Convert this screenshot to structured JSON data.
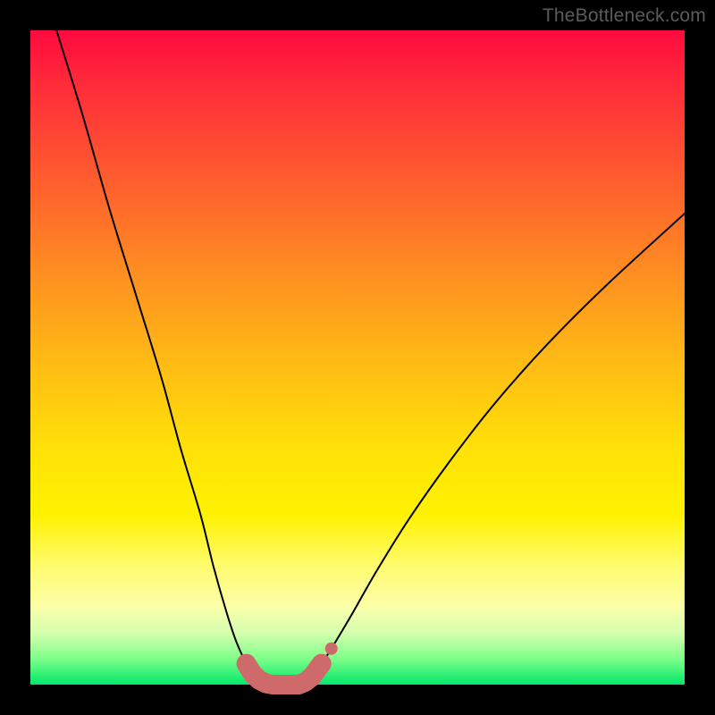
{
  "watermark": "TheBottleneck.com",
  "colors": {
    "frame": "#000000",
    "curve": "#000000",
    "marker": "#cf6a6a"
  },
  "chart_data": {
    "type": "line",
    "title": "",
    "xlabel": "",
    "ylabel": "",
    "xlim": [
      0,
      100
    ],
    "ylim": [
      0,
      100
    ],
    "grid": false,
    "series": [
      {
        "name": "left-branch",
        "x": [
          4,
          8,
          12,
          16,
          20,
          23,
          26,
          28,
          30,
          31.5,
          33,
          34,
          35,
          36,
          37
        ],
        "y": [
          100,
          87,
          73,
          60,
          47,
          36,
          26,
          18,
          11,
          6.5,
          3.2,
          1.6,
          0.7,
          0.2,
          0
        ]
      },
      {
        "name": "right-branch",
        "x": [
          41,
          42,
          43,
          44,
          46,
          49,
          53,
          58,
          64,
          71,
          79,
          88,
          100
        ],
        "y": [
          0,
          0.4,
          1.2,
          2.4,
          5.5,
          10.5,
          17.5,
          25.5,
          34,
          43,
          52,
          61,
          72
        ]
      },
      {
        "name": "floor",
        "x": [
          37,
          38,
          39,
          40,
          41
        ],
        "y": [
          0,
          0,
          0,
          0,
          0
        ]
      }
    ],
    "markers": {
      "name": "highlight-cluster",
      "points": [
        {
          "x": 33.0,
          "y": 3.2
        },
        {
          "x": 34.0,
          "y": 1.6
        },
        {
          "x": 35.0,
          "y": 0.7
        },
        {
          "x": 36.0,
          "y": 0.2
        },
        {
          "x": 37.0,
          "y": 0.0
        },
        {
          "x": 38.0,
          "y": 0.0
        },
        {
          "x": 39.0,
          "y": 0.0
        },
        {
          "x": 40.0,
          "y": 0.0
        },
        {
          "x": 41.0,
          "y": 0.0
        },
        {
          "x": 42.0,
          "y": 0.4
        },
        {
          "x": 43.0,
          "y": 1.2
        },
        {
          "x": 44.5,
          "y": 3.2
        }
      ],
      "isolated_point": {
        "x": 46.0,
        "y": 5.5
      }
    }
  }
}
